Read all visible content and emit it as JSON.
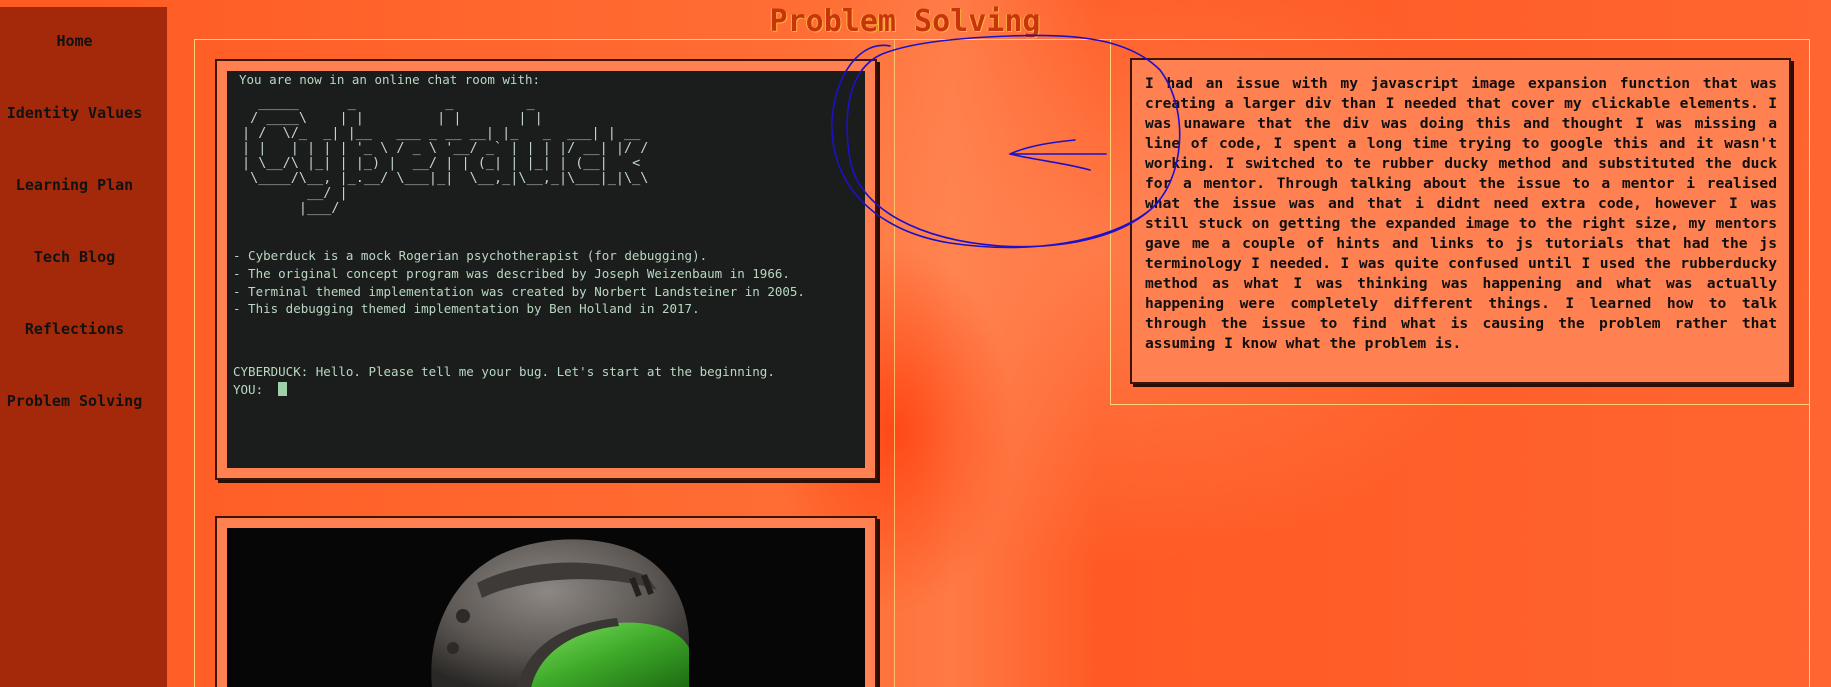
{
  "page": {
    "title": "Problem Solving"
  },
  "sidebar": {
    "items": [
      {
        "label": "Home"
      },
      {
        "label": "Identity Values"
      },
      {
        "label": "Learning Plan"
      },
      {
        "label": "Tech Blog"
      },
      {
        "label": "Reflections"
      },
      {
        "label": "Problem Solving"
      }
    ]
  },
  "terminal": {
    "header": "You are now in an online chat room with:",
    "ascii_logo": "  _____      _           _         _\n / ____\\    | |         | |       | |\n| /  \\/_  _| |__   ___ _ __ __| |_   _  ___| | __\n| |   | | | | '_ \\ / _ \\ '__/ _` | | | |/ __| |/ /\n| \\__/\\ |_| | |_) |  __/ | | (_| | |_| | (__|   <\n \\____/\\__, |_.__/ \\___|_|  \\__,_|\\__,_|\\___|_|\\_\\\n        __/ |\n       |___/",
    "bullets": [
      "- Cyberduck is a mock Rogerian psychotherapist (for debugging).",
      "- The original concept program was described by Joseph Weizenbaum in 1966.",
      "- Terminal themed implementation was created by Norbert Landsteiner in 2005.",
      "- This debugging themed implementation by Ben Holland in 2017."
    ],
    "bot_message": "CYBERDUCK: Hello. Please tell me your bug. Let's start at the beginning.",
    "prompt": "YOU:"
  },
  "description": {
    "text": "I had an issue with my javascript image expansion function that was creating a larger div than I needed that cover my clickable elements. I was unaware that the div was doing this and thought I was missing a line of code, I spent a long time trying to google this and it wasn't working. I switched to te rubber ducky method and substituted the duck for a mentor. Through talking about the issue to a mentor i realised what the issue was and that i didnt need extra code, however I was still stuck on getting the expanded image to the right size, my mentors gave me a couple of hints and links to js tutorials that had the js terminology I needed. I was quite confused until I used the rubberducky method as what I was thinking was happening and what was actually happening were completely different things. I learned how to talk through the issue to find what is causing the problem rather that assuming I know what the problem is."
  },
  "colors": {
    "sidebar": "#a3290a",
    "background": "#ff6530",
    "terminal_bg": "#1a1d1b",
    "terminal_text": "#b9d7c2",
    "card": "#ff8050",
    "annotation_ink": "#1d10c8"
  }
}
